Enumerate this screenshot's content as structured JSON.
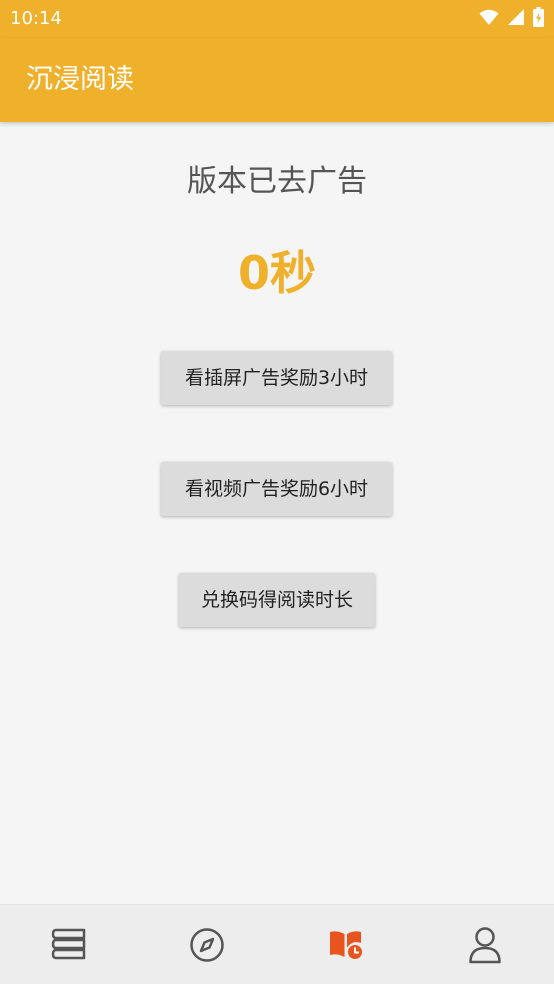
{
  "status_bar": {
    "time": "10:14",
    "icons": [
      "wifi-icon",
      "signal-icon",
      "battery-charging-icon"
    ]
  },
  "toolbar": {
    "title": "沉浸阅读"
  },
  "main": {
    "status_text": "版本已去广告",
    "time_remaining": "0秒",
    "buttons": [
      {
        "label": "看插屏广告奖励3小时"
      },
      {
        "label": "看视频广告奖励6小时"
      },
      {
        "label": "兑换码得阅读时长"
      }
    ]
  },
  "bottom_nav": {
    "items": [
      {
        "icon": "bookshelf-icon",
        "active": false
      },
      {
        "icon": "compass-icon",
        "active": false
      },
      {
        "icon": "reading-time-icon",
        "active": true
      },
      {
        "icon": "person-icon",
        "active": false
      }
    ]
  },
  "colors": {
    "accent": "#efb12c",
    "nav_active": "#e8541e",
    "nav_inactive": "#555555"
  }
}
